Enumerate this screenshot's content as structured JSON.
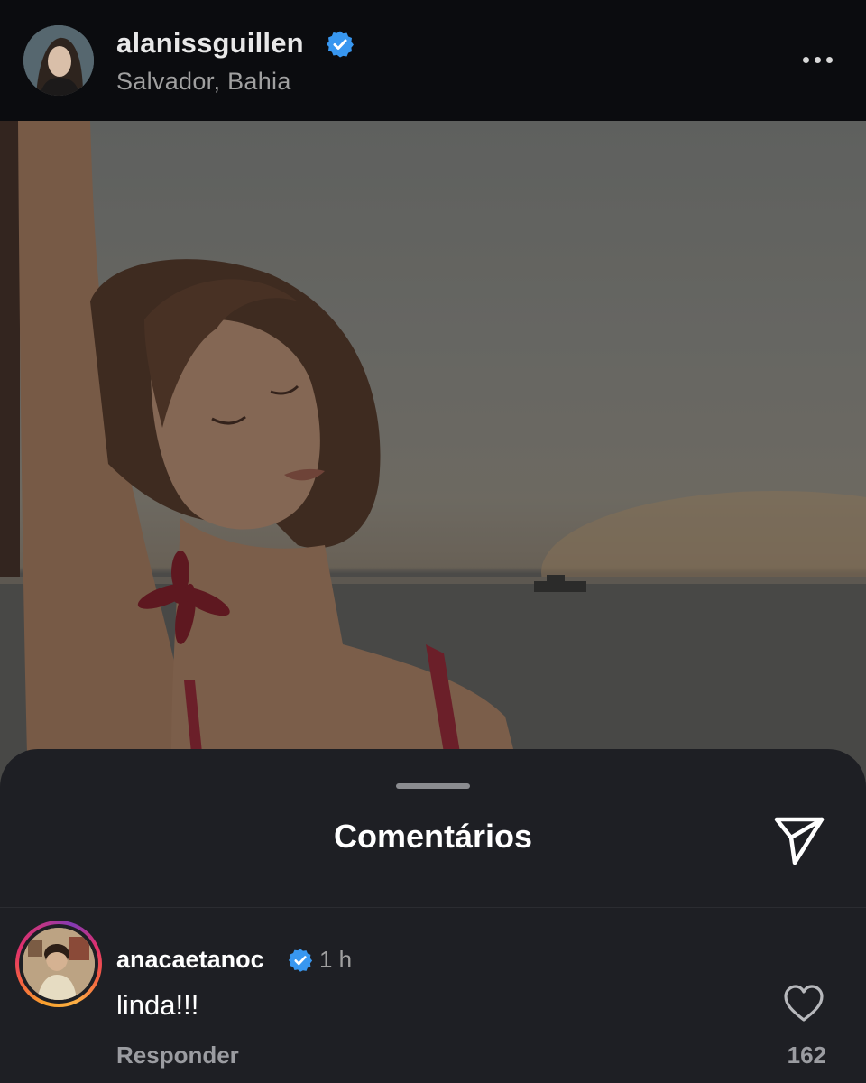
{
  "post": {
    "username": "alanissguillen",
    "location": "Salvador, Bahia",
    "verified": true
  },
  "comments_sheet": {
    "title": "Comentários",
    "comments": [
      {
        "username": "anacaetanoc",
        "verified": true,
        "time": "1 h",
        "text": "linda!!!",
        "reply_label": "Responder",
        "like_count": "162"
      }
    ]
  },
  "icons": {
    "verified": "verified-badge-icon",
    "more": "more-options-icon",
    "share": "paper-plane-icon",
    "like": "heart-icon"
  },
  "colors": {
    "background": "#0b0c0f",
    "sheet": "#1e1f24",
    "verified_blue": "#3897f0",
    "secondary_text": "#a0a0a0"
  }
}
